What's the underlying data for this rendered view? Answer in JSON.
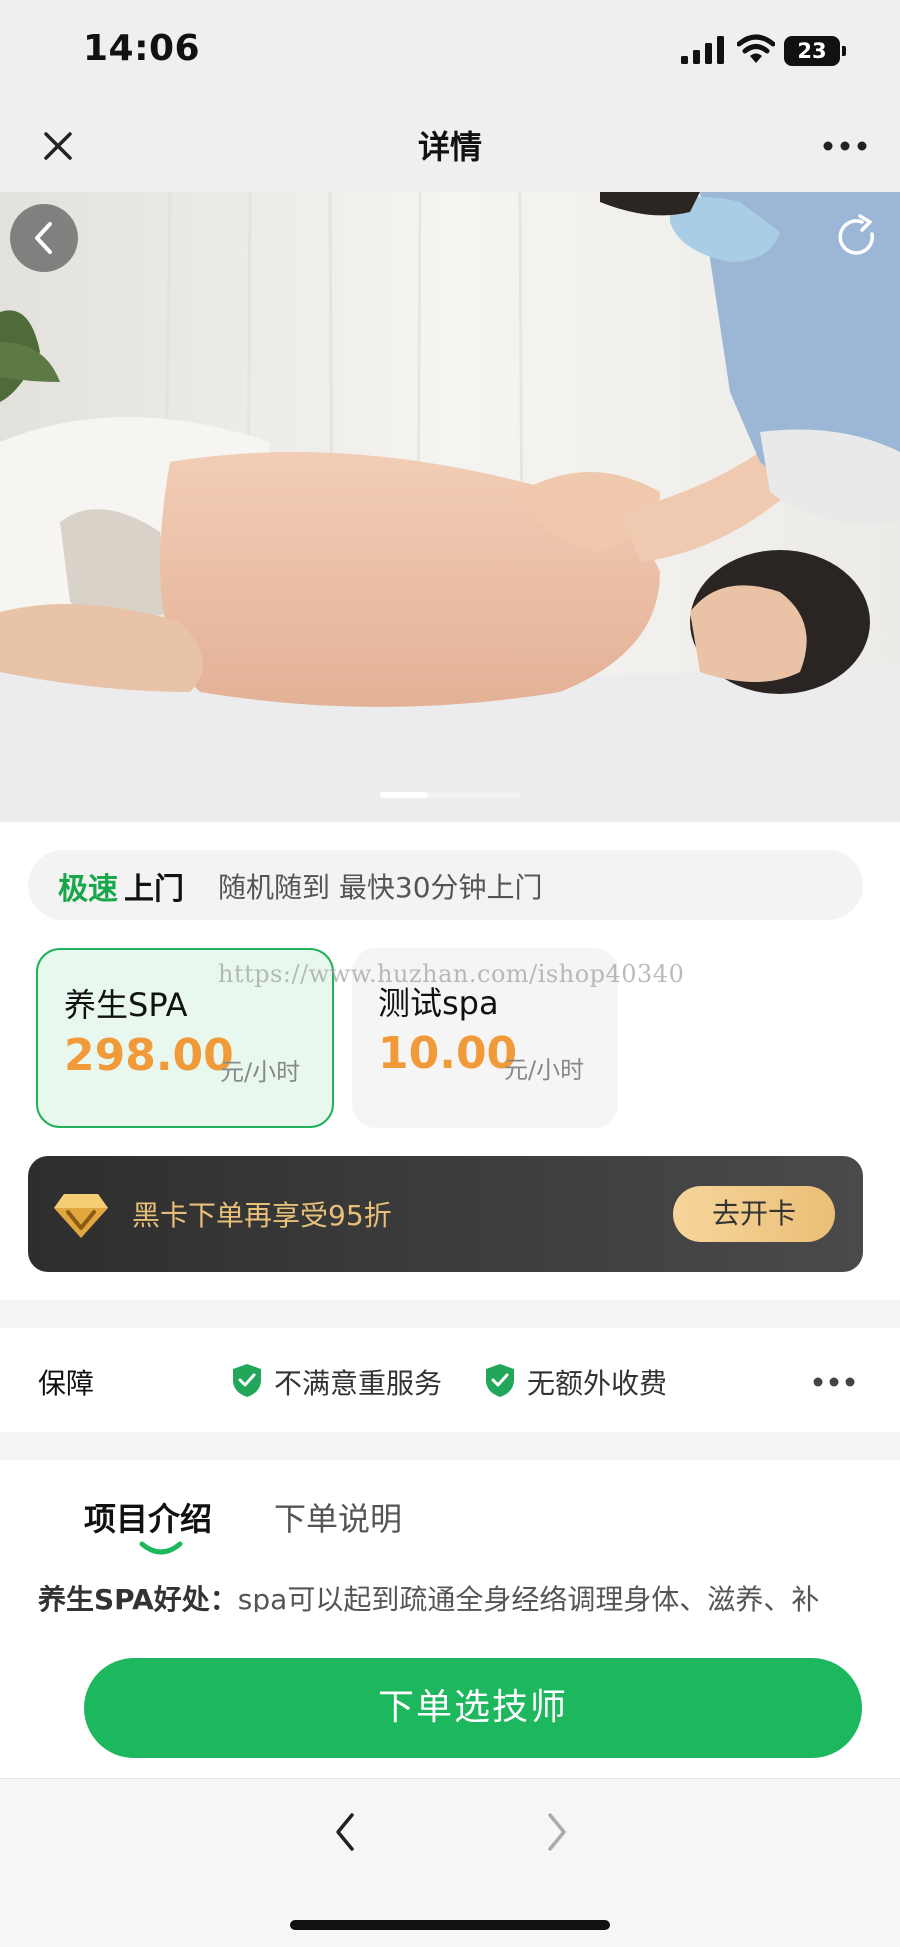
{
  "status_bar": {
    "time": "14:06",
    "battery": "23"
  },
  "header": {
    "title": "详情"
  },
  "icons": {
    "close": "close-icon",
    "more": "more-dots-icon",
    "back": "chevron-left-icon",
    "share": "share-refresh-icon",
    "shield": "shield-check-icon",
    "diamond": "diamond-icon",
    "forward": "chevron-right-icon"
  },
  "carousel": {
    "active_index": 1,
    "total": 3
  },
  "express": {
    "highlight": "极速",
    "label": "上门",
    "description": "随机随到 最快30分钟上门"
  },
  "services": [
    {
      "name": "养生SPA",
      "price": "298.00",
      "unit": "元/小时",
      "selected": true
    },
    {
      "name": "测试spa",
      "price": "10.00",
      "unit": "元/小时",
      "selected": false
    }
  ],
  "watermark": "https://www.huzhan.com/ishop40340",
  "vip": {
    "text": "黑卡下单再享受95折",
    "button": "去开卡"
  },
  "guarantee": {
    "label": "保障",
    "items": [
      "不满意重服务",
      "无额外收费"
    ]
  },
  "detail": {
    "tabs": [
      "项目介绍",
      "下单说明"
    ],
    "intro_label": "养生SPA好处：",
    "intro_text": "spa可以起到疏通全身经络调理身体、滋养、补"
  },
  "cta": {
    "label": "下单选技师"
  },
  "colors": {
    "brand_green": "#1db75d",
    "price_orange": "#f09a3a",
    "vip_gold": "#e7bf78",
    "vip_dark": "#2e2e2e"
  }
}
